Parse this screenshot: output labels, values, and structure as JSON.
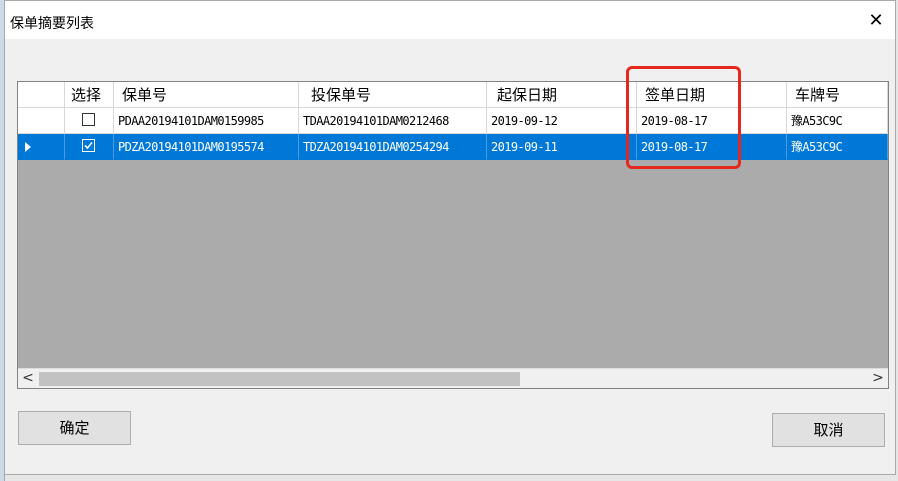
{
  "window": {
    "title": "保单摘要列表",
    "close_glyph": "✕"
  },
  "grid": {
    "columns": [
      "",
      "选择",
      "保单号",
      "投保单号",
      "起保日期",
      "签单日期",
      "车牌号"
    ],
    "rows": [
      {
        "selected": false,
        "checked": false,
        "policy_no": "PDAA20194101DAM0159985",
        "proposal_no": "TDAA20194101DAM0212468",
        "start_date": "2019-09-12",
        "sign_date": "2019-08-17",
        "plate_no": "豫A53C9C"
      },
      {
        "selected": true,
        "checked": true,
        "policy_no": "PDZA20194101DAM0195574",
        "proposal_no": "TDZA20194101DAM0254294",
        "start_date": "2019-09-11",
        "sign_date": "2019-08-17",
        "plate_no": "豫A53C9C"
      }
    ],
    "scroll_left_glyph": "<",
    "scroll_right_glyph": ">"
  },
  "buttons": {
    "ok": "确定",
    "cancel": "取消"
  },
  "colors": {
    "selection": "#0078d7",
    "highlight_box": "#e5281e",
    "grid_background": "#ababab"
  }
}
